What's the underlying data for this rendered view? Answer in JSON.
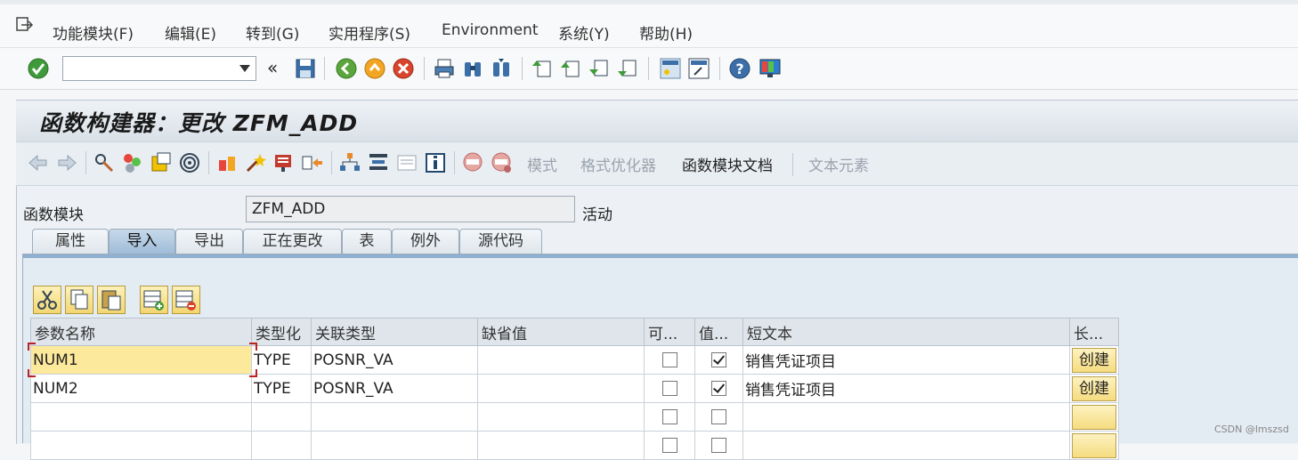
{
  "menu": {
    "items": [
      "功能模块(F)",
      "编辑(E)",
      "转到(G)",
      "实用程序(S)",
      "Environment",
      "系统(Y)",
      "帮助(H)"
    ]
  },
  "toolbar": {
    "command_value": "",
    "back_symbol": "«"
  },
  "title": "函数构建器：更改 ZFM_ADD",
  "app_toolbar": {
    "mode_label": "模式",
    "pretty_printer_label": "格式优化器",
    "fm_doc_label": "函数模块文档",
    "text_elements_label": "文本元素"
  },
  "function_module": {
    "label": "函数模块",
    "value": "ZFM_ADD",
    "status": "活动"
  },
  "tabs": [
    "属性",
    "导入",
    "导出",
    "正在更改",
    "表",
    "例外",
    "源代码"
  ],
  "active_tab": 1,
  "grid": {
    "headers": [
      "参数名称",
      "类型化",
      "关联类型",
      "缺省值",
      "可...",
      "值...",
      "短文本",
      "长..."
    ],
    "rows": [
      {
        "name": "NUM1",
        "typing": "TYPE",
        "ref_type": "POSNR_VA",
        "default": "",
        "optional": false,
        "pass_value": true,
        "short_text": "销售凭证项目",
        "long_btn": "创建"
      },
      {
        "name": "NUM2",
        "typing": "TYPE",
        "ref_type": "POSNR_VA",
        "default": "",
        "optional": false,
        "pass_value": true,
        "short_text": "销售凭证项目",
        "long_btn": "创建"
      },
      {
        "name": "",
        "typing": "",
        "ref_type": "",
        "default": "",
        "optional": false,
        "pass_value": false,
        "short_text": "",
        "long_btn": ""
      },
      {
        "name": "",
        "typing": "",
        "ref_type": "",
        "default": "",
        "optional": false,
        "pass_value": false,
        "short_text": "",
        "long_btn": ""
      }
    ]
  },
  "watermark": "CSDN @lmszsd"
}
